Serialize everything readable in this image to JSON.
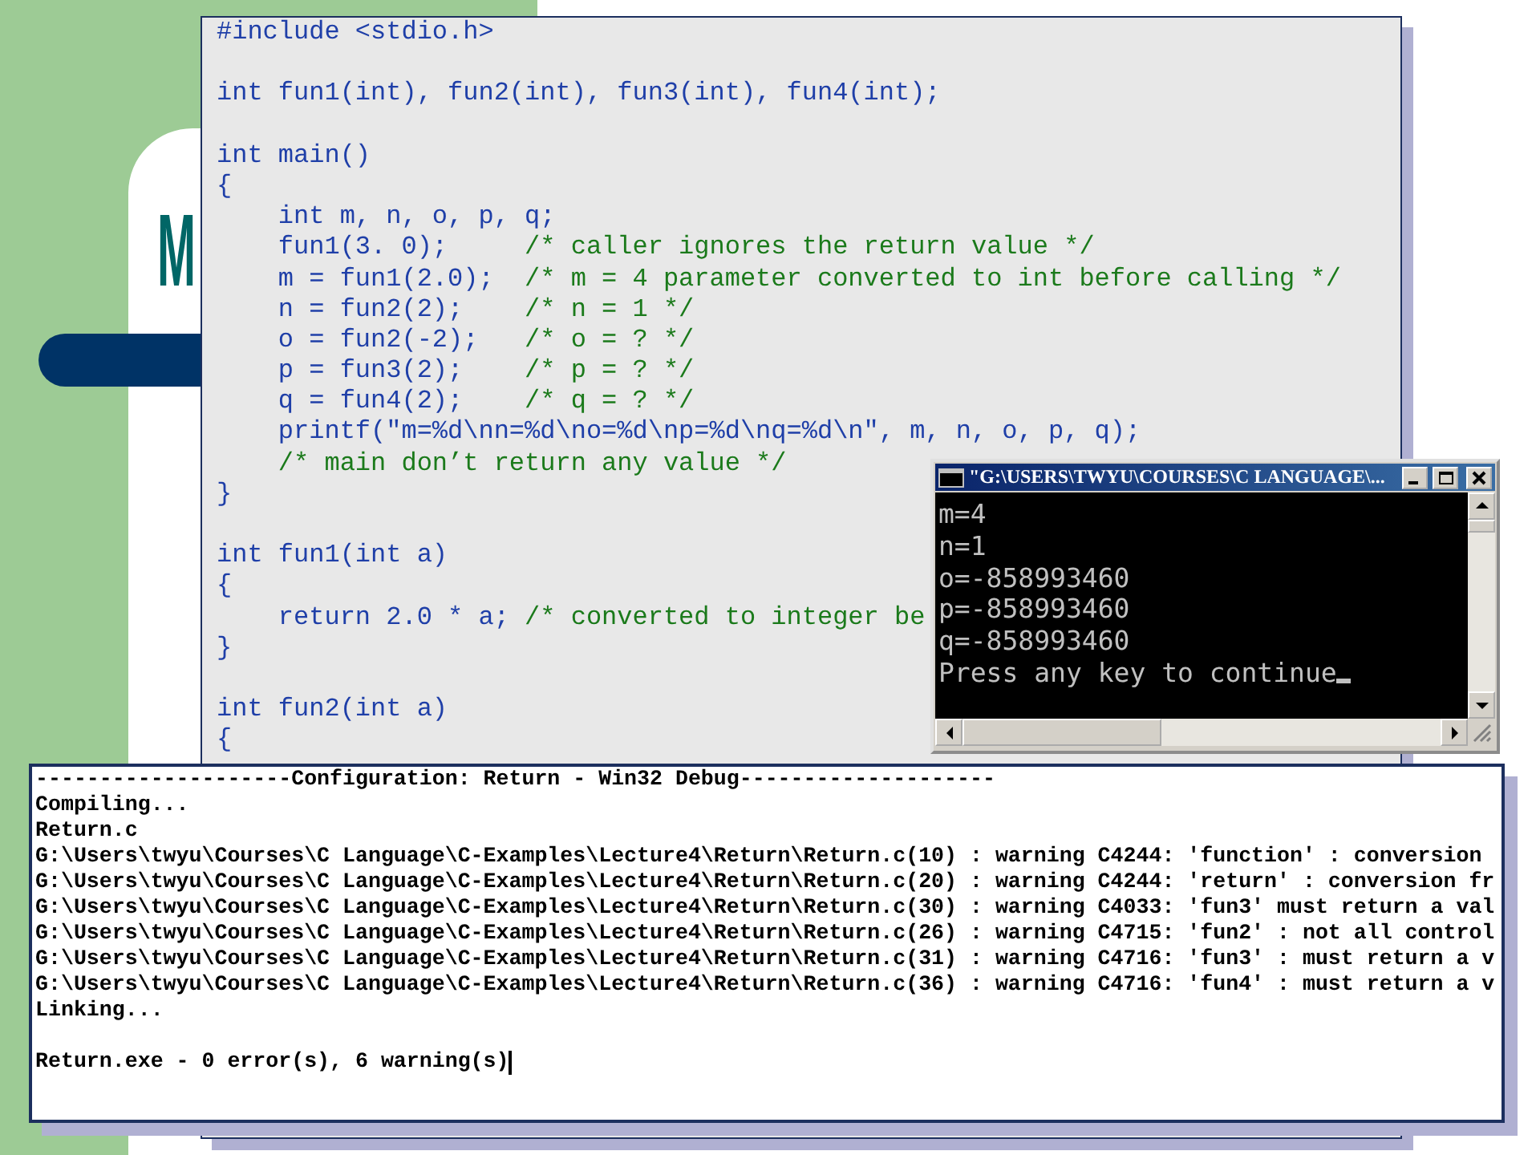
{
  "slide": {
    "title": "M"
  },
  "source_code": {
    "blocks": [
      [
        {
          "code": "#include <stdio.h>"
        }
      ],
      [
        {
          "code": "int fun1(int), fun2(int), fun3(int), fun4(int);"
        }
      ],
      [
        {
          "code": "int main()"
        },
        {
          "code": "{"
        },
        {
          "code": "    int m, n, o, p, q;"
        },
        {
          "code": "    fun1(3. 0);     ",
          "comment": "/* caller ignores the return value */"
        },
        {
          "code": "    m = fun1(2.0);  ",
          "comment": "/* m = 4 parameter converted to int before calling */"
        },
        {
          "code": "    n = fun2(2);    ",
          "comment": "/* n = 1 */"
        },
        {
          "code": "    o = fun2(-2);   ",
          "comment": "/* o = ? */"
        },
        {
          "code": "    p = fun3(2);    ",
          "comment": "/* p = ? */"
        },
        {
          "code": "    q = fun4(2);    ",
          "comment": "/* q = ? */"
        },
        {
          "code": "    printf(\"m=%d\\nn=%d\\no=%d\\np=%d\\nq=%d\\n\", m, n, o, p, q);"
        },
        {
          "comment": "    /* main don’t return any value */"
        },
        {
          "code": "}"
        }
      ],
      [
        {
          "code": "int fun1(int a)"
        },
        {
          "code": "{"
        },
        {
          "code": "    return 2.0 * a; ",
          "comment": "/* converted to integer be"
        },
        {
          "code": "}"
        }
      ],
      [
        {
          "code": "int fun2(int a)"
        },
        {
          "code": "{"
        }
      ]
    ]
  },
  "console_window": {
    "title": "\"G:\\USERS\\TWYU\\COURSES\\C LANGUAGE\\...",
    "output": [
      "m=4",
      "n=1",
      "o=-858993460",
      "p=-858993460",
      "q=-858993460",
      "Press any key to continue"
    ]
  },
  "build_output": {
    "lines": [
      "--------------------Configuration: Return - Win32 Debug--------------------",
      "Compiling...",
      "Return.c",
      "G:\\Users\\twyu\\Courses\\C Language\\C-Examples\\Lecture4\\Return\\Return.c(10) : warning C4244: 'function' : conversion",
      "G:\\Users\\twyu\\Courses\\C Language\\C-Examples\\Lecture4\\Return\\Return.c(20) : warning C4244: 'return' : conversion fr",
      "G:\\Users\\twyu\\Courses\\C Language\\C-Examples\\Lecture4\\Return\\Return.c(30) : warning C4033: 'fun3' must return a val",
      "G:\\Users\\twyu\\Courses\\C Language\\C-Examples\\Lecture4\\Return\\Return.c(26) : warning C4715: 'fun2' : not all control",
      "G:\\Users\\twyu\\Courses\\C Language\\C-Examples\\Lecture4\\Return\\Return.c(31) : warning C4716: 'fun3' : must return a v",
      "G:\\Users\\twyu\\Courses\\C Language\\C-Examples\\Lecture4\\Return\\Return.c(36) : warning C4716: 'fun4' : must return a v",
      "Linking..."
    ],
    "summary": "Return.exe - 0 error(s), 6 warning(s)"
  }
}
